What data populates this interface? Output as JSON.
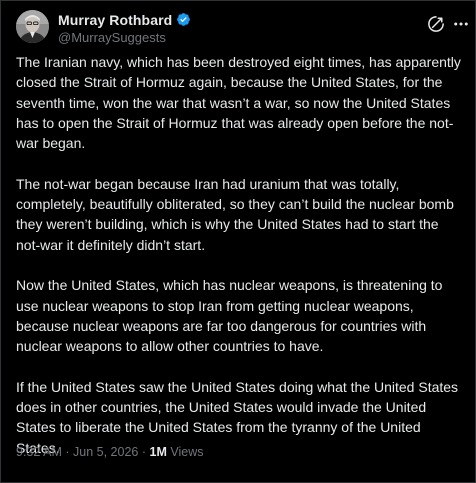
{
  "author": {
    "display_name": "Murray Rothbard",
    "handle": "@MurraySuggests",
    "verified": true
  },
  "icons": {
    "verified": "verified-badge-icon",
    "grok": "grok-icon",
    "more": "more-options-icon",
    "avatar": "avatar"
  },
  "colors": {
    "background": "#000000",
    "text": "#e7e9ea",
    "secondary": "#71767b",
    "verified": "#1d9bf0"
  },
  "tweet": {
    "paragraphs": [
      "The Iranian navy, which has been destroyed eight times, has apparently closed the Strait of Hormuz again, because the United States, for the seventh time, won the war that wasn’t a war, so now the United States has to open the Strait of Hormuz that was already open before the not-war began.",
      "The not-war began because Iran had uranium that was totally, completely, beautifully obliterated, so they can’t build the nuclear bomb they weren’t building, which is why the United States had to start the not-war it definitely didn’t start.",
      "Now the United States, which has nuclear weapons, is threatening to use nuclear weapons to stop Iran from getting nuclear weapons, because nuclear weapons are far too dangerous for countries with nuclear weapons to allow other countries to have.",
      "If the United States saw the United States doing what the United States does in other countries, the United States would invade the United States to liberate the United States from the tyranny of the United States."
    ],
    "time": "9:32 AM",
    "separator": "·",
    "date": "Jun 5, 2026",
    "views_count": "1M",
    "views_label": "Views"
  }
}
